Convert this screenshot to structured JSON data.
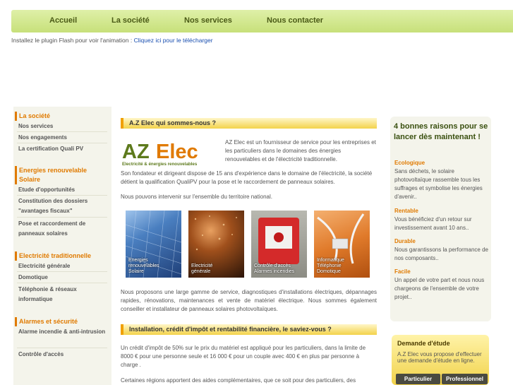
{
  "nav": [
    "Accueil",
    "La société",
    "Nos services",
    "Nous contacter"
  ],
  "flash": {
    "text": "Installez le plugin Flash pour voir l'animation : ",
    "link": "Cliquez ici pour le télécharger"
  },
  "sidebar": {
    "sections": [
      {
        "title": "La société",
        "items": [
          "Nos services",
          "Nos engagements",
          "La certification Quali PV"
        ]
      },
      {
        "title": "Energies renouvelable Solaire",
        "items": [
          "Etude d'opportunités",
          "Constitution des dossiers \"avantages fiscaux\"",
          "Pose et raccordement de panneaux solaires"
        ]
      },
      {
        "title": "Electricité traditionnelle",
        "items": [
          "Electricité générale",
          "Domotique",
          "Téléphonie & réseaux informatique"
        ]
      },
      {
        "title": "Alarmes et sécurité",
        "items": [
          "Alarme incendie & anti-intrusion",
          "Contrôle d'accès"
        ]
      }
    ]
  },
  "main": {
    "section1_title": "A.Z Elec qui sommes-nous ?",
    "logo": {
      "text": "AZElec",
      "tagline": "Electricité & énergies renouvelables"
    },
    "intro": "AZ Elec est un fournisseur de service pour les entreprises et les particuliers dans le domaines des énergies renouvelables et de l'électricité traditionnelle.",
    "p2": "Son fondateur et dirigeant dispose de 15 ans d'expérience dans le domaine de l'électricité, la société détient la qualification QualiPV pour la pose et le raccordement de panneaux solaires.",
    "p3": "Nous pouvons intervenir sur l'ensemble du territoire national.",
    "photos": [
      {
        "caption": "Energies renouvelables Solaire"
      },
      {
        "caption": "Electricité générale"
      },
      {
        "caption": "Contrôle d'accès Alarmes incendies"
      },
      {
        "caption": "Informatique Téléphonie Domotique"
      }
    ],
    "p4": "Nous proposons une large gamme de service, diagnostiques d'installations électriques, dépannages rapides, rénovations, maintenances et vente de matériel électrique. Nous sommes également conseiller et installateur de panneaux solaires photovoltaïques.",
    "section2_title": "Installation, crédit d'impôt et rentabilité financière, le saviez-vous ?",
    "p5": "Un crédit d'impôt de 50% sur le prix du matériel est appliqué pour les particuliers, dans la limite de 8000 € pour une personne seule et 16 000 € pour un couple avec 400 € en plus par personne à charge .",
    "p6": "Certaines régions apportent des aides complémentaires, que ce soit pour des particuliers, des"
  },
  "right": {
    "title": "4 bonnes raisons pour se lancer dès maintenant !",
    "reasons": [
      {
        "h": "Ecologique",
        "t": "Sans déchets, le solaire photovoltaïque rassemble tous les suffrages et symbolise les énergies d'avenir.."
      },
      {
        "h": "Rentable",
        "t": "Vous bénéficiez d'un retour sur investissement avant 10 ans.."
      },
      {
        "h": "Durable",
        "t": "Nous garantissons la performance de nos composants.."
      },
      {
        "h": "Facile",
        "t": "Un appel de votre part et nous nous chargeons de l'ensemble de votre projet.."
      }
    ],
    "demande": {
      "title": "Demande d'étude",
      "text": "A.Z Elec vous propose d'effectuer une demande d'étude en ligne.",
      "btn1": "Particulier",
      "btn2": "Professionnel"
    }
  },
  "colors": {
    "accent": "#e07a00",
    "nav": "#c7e07a",
    "highlight": "#f3d24a"
  }
}
